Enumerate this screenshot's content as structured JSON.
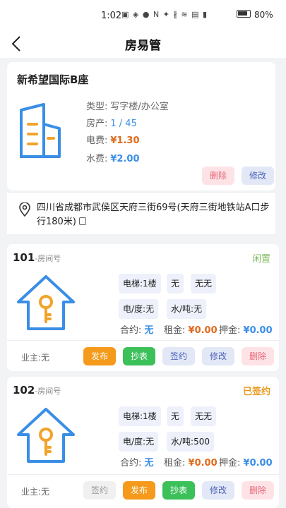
{
  "status_bar": {
    "time": "1:02",
    "icons": "▣ ◈ ● N ✦ ∦ ≋ ▤ ▮",
    "battery": "80%"
  },
  "nav": {
    "title": "房易管"
  },
  "building": {
    "name": "新希望国际B座",
    "type_label": "类型:",
    "type_value": "写字楼/办公室",
    "units_label": "房产:",
    "units_value": "1 / 45",
    "elec_label": "电费:",
    "elec_value": "¥1.30",
    "water_label": "水费:",
    "water_value": "¥2.00",
    "delete_label": "删除",
    "edit_label": "修改",
    "address": "四川省成都市武侯区天府三街69号(天府三街地铁站A口步行180米)"
  },
  "rooms": [
    {
      "number": "101",
      "number_suffix": "-房间号",
      "status": "闲置",
      "status_color": "#7dbb5b",
      "tags": [
        "电梯:1楼",
        "无",
        "无无",
        "电/度:无",
        "水/吨:无"
      ],
      "contract_label": "合约:",
      "contract_value": "无",
      "rent_label": "租金:",
      "rent_value": "¥0.00",
      "deposit_label": "押金:",
      "deposit_value": "¥0.00",
      "owner": "业主:无",
      "buttons": [
        "发布",
        "抄表",
        "签约",
        "修改",
        "删除"
      ]
    },
    {
      "number": "102",
      "number_suffix": "-房间号",
      "status": "已签约",
      "status_color": "#e9961c",
      "tags": [
        "电梯:1楼",
        "无",
        "无无",
        "电/度:无",
        "水/吨:500"
      ],
      "contract_label": "合约:",
      "contract_value": "无",
      "rent_label": "租金:",
      "rent_value": "¥0.00",
      "deposit_label": "押金:",
      "deposit_value": "¥0.00",
      "owner": "业主:无",
      "buttons": [
        "签约",
        "发布",
        "抄表",
        "修改",
        "删除"
      ]
    }
  ],
  "colors": {
    "accent_blue": "#3a8ee6",
    "price_orange": "#e06a1c",
    "value_blue": "#3a8ee6",
    "key_orange": "#f3a32a"
  }
}
